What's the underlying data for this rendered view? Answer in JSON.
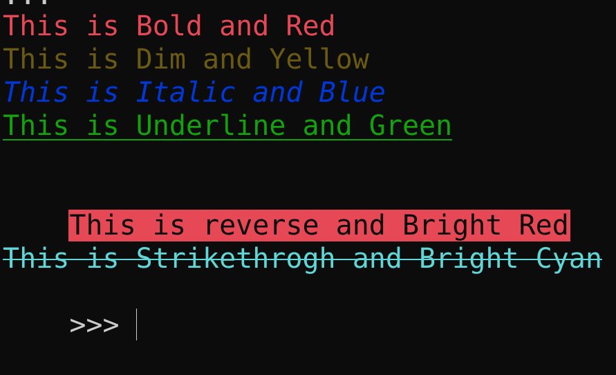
{
  "terminal": {
    "background": "#0c0c0c",
    "lines": {
      "partial_top": "...",
      "bold_red": "This is Bold and Red",
      "dim_yellow": "This is Dim and Yellow",
      "italic_blue": "This is Italic and Blue",
      "underline_green": "This is Underline and Green",
      "reverse_bright_red": "This is reverse and Bright Red",
      "strike_bright_cyan": "This is Strikethrogh and Bright Cyan",
      "prompt": ">>>"
    },
    "colors": {
      "red": "#e74856",
      "dim_yellow": "#6b5a12",
      "blue": "#0037da",
      "green": "#13a10e",
      "bright_red_bg": "#e74856",
      "reverse_fg": "#0c0c0c",
      "bright_cyan": "#61d6d6",
      "default_fg": "#cccccc"
    }
  }
}
